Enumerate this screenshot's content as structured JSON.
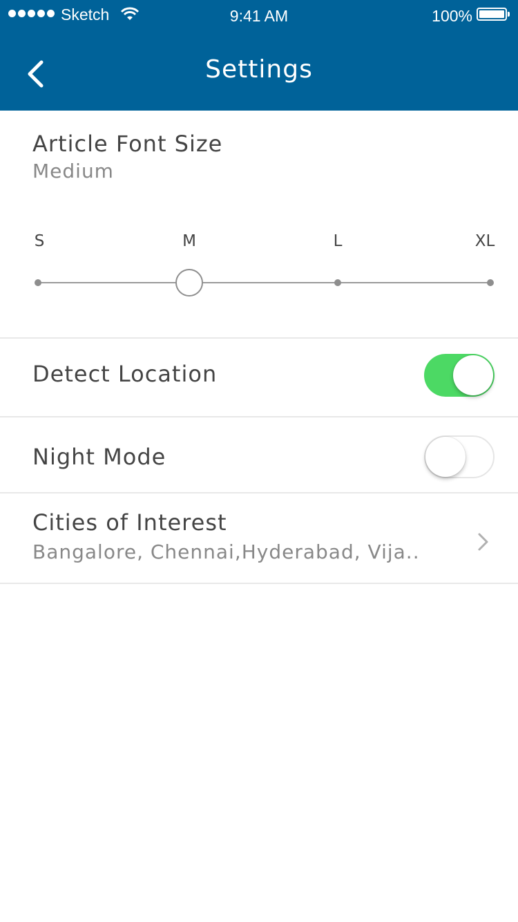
{
  "status_bar": {
    "carrier": "Sketch",
    "time": "9:41 AM",
    "battery": "100%"
  },
  "header": {
    "title": "Settings",
    "back_icon": "chevron-left-icon"
  },
  "font_size": {
    "title": "Article Font Size",
    "value": "Medium",
    "stops": [
      "S",
      "M",
      "L",
      "XL"
    ],
    "selected_index": 1
  },
  "detect_location": {
    "label": "Detect Location",
    "enabled": true
  },
  "night_mode": {
    "label": "Night Mode",
    "enabled": false
  },
  "cities": {
    "label": "Cities of Interest",
    "value": "Bangalore, Chennai,Hyderabad, Vija.."
  },
  "colors": {
    "header": "#006299",
    "toggle_on": "#4cd964",
    "text_primary": "#444444",
    "text_secondary": "#888888"
  }
}
